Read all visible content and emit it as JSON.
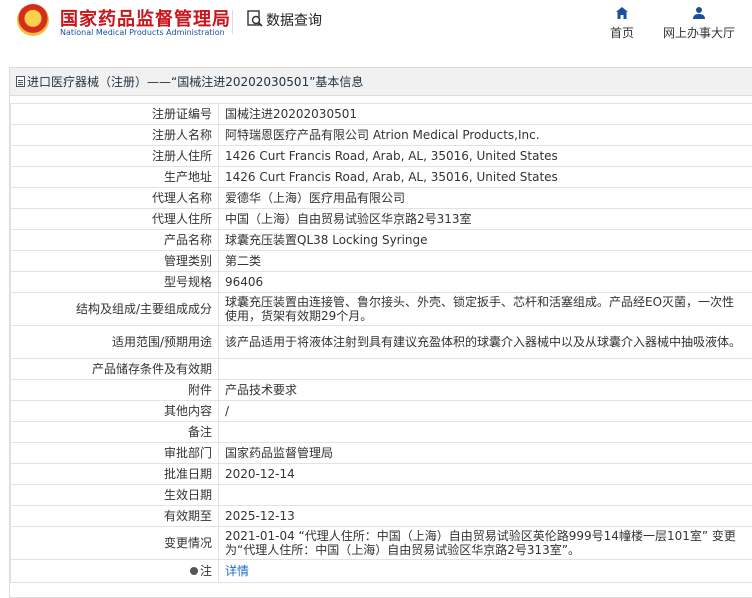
{
  "header": {
    "org_cn": "国家药品监督管理局",
    "org_en": "National Medical Products Administration",
    "section": "数据查询",
    "nav": [
      {
        "label": "首页",
        "icon": "home-icon"
      },
      {
        "label": "网上办事大厅",
        "icon": "user-icon"
      }
    ]
  },
  "panel": {
    "title": "进口医疗器械（注册）——“国械注进20202030501”基本信息"
  },
  "rows": [
    {
      "label": "注册证编号",
      "value": "国械注进20202030501"
    },
    {
      "label": "注册人名称",
      "value": "阿特瑞恩医疗产品有限公司 Atrion Medical Products,Inc."
    },
    {
      "label": "注册人住所",
      "value": "1426 Curt Francis Road, Arab, AL, 35016, United States"
    },
    {
      "label": "生产地址",
      "value": "1426 Curt Francis Road, Arab, AL, 35016, United States"
    },
    {
      "label": "代理人名称",
      "value": "爱德华（上海）医疗用品有限公司"
    },
    {
      "label": "代理人住所",
      "value": "中国（上海）自由贸易试验区华京路2号313室"
    },
    {
      "label": "产品名称",
      "value": "球囊充压装置QL38 Locking Syringe"
    },
    {
      "label": "管理类别",
      "value": "第二类"
    },
    {
      "label": "型号规格",
      "value": "96406"
    },
    {
      "label": "结构及组成/主要组成成分",
      "value": "球囊充压装置由连接管、鲁尔接头、外壳、锁定扳手、芯杆和活塞组成。产品经EO灭菌，一次性使用，货架有效期29个月。"
    },
    {
      "label": "适用范围/预期用途",
      "value": "该产品适用于将液体注射到具有建议充盈体积的球囊介入器械中以及从球囊介入器械中抽吸液体。"
    },
    {
      "label": "产品储存条件及有效期",
      "value": ""
    },
    {
      "label": "附件",
      "value": "产品技术要求"
    },
    {
      "label": "其他内容",
      "value": "/"
    },
    {
      "label": "备注",
      "value": ""
    },
    {
      "label": "审批部门",
      "value": "国家药品监督管理局"
    },
    {
      "label": "批准日期",
      "value": "2020-12-14"
    },
    {
      "label": "生效日期",
      "value": ""
    },
    {
      "label": "有效期至",
      "value": "2025-12-13"
    },
    {
      "label": "变更情况",
      "value": "2021-01-04 “代理人住所：中国（上海）自由贸易试验区英伦路999号14幢楼一层101室” 变更为“代理人住所：中国（上海）自由贸易试验区华京路2号313室”。"
    },
    {
      "label": "注",
      "value": "详情",
      "icon": "lightbulb-icon"
    }
  ]
}
